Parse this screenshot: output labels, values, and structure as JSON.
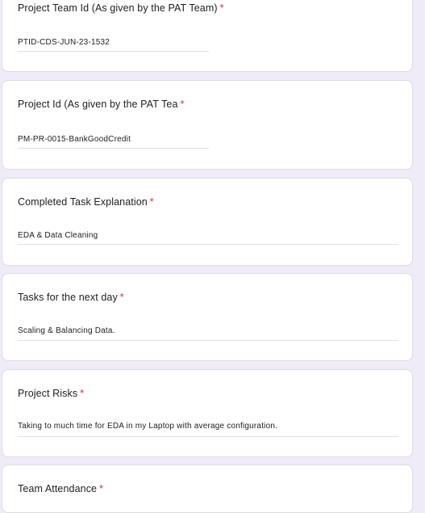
{
  "questions": [
    {
      "title": "Project Team Id (As given by the PAT Team)",
      "required": "*",
      "answer": "PTID-CDS-JUN-23-1532"
    },
    {
      "title": "Project Id (As given by the PAT Tea",
      "required": "*",
      "answer": "PM-PR-0015-BankGoodCredit"
    },
    {
      "title": "Completed Task Explanation",
      "required": "*",
      "answer": "EDA & Data Cleaning"
    },
    {
      "title": "Tasks for the next day",
      "required": "*",
      "answer": "Scaling & Balancing Data."
    },
    {
      "title": "Project Risks",
      "required": "*",
      "answer": "Taking to much time for EDA in my Laptop with average configuration."
    },
    {
      "title": "Team Attendance",
      "required": "*"
    }
  ],
  "colors": {
    "page_background": "#f0ebf8",
    "card_background": "#ffffff",
    "required_asterisk": "#d93025",
    "text": "#202124"
  }
}
